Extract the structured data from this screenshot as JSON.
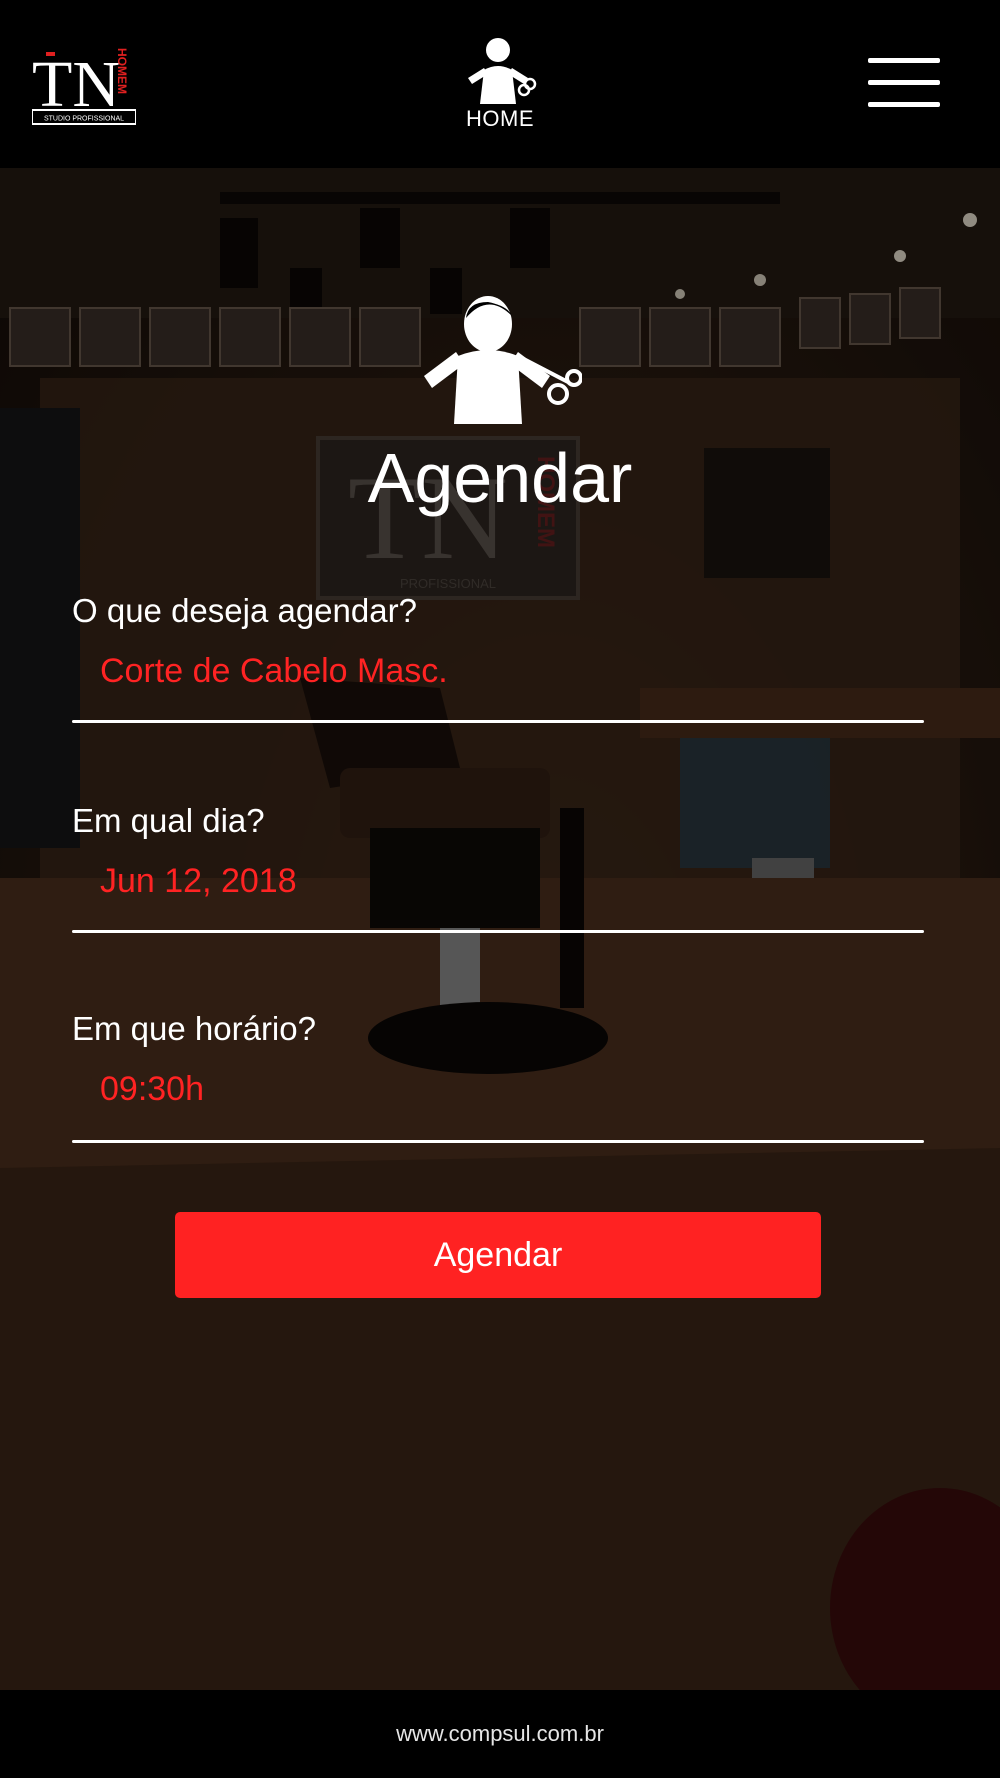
{
  "header": {
    "logo": {
      "letters": "TN",
      "vertical_text": "HOMEM",
      "subtitle": "STUDIO PROFISSIONAL"
    },
    "home_label": "HOME",
    "menu_icon": "hamburger-menu-icon"
  },
  "hero": {
    "icon": "barber-scissors-icon",
    "title": "Agendar",
    "background_logo": {
      "letters": "TN",
      "vertical_text": "HOMEM",
      "subtitle": "PROFISSIONAL"
    }
  },
  "form": {
    "service": {
      "label": "O que deseja agendar?",
      "value": "Corte de Cabelo Masc."
    },
    "date": {
      "label": "Em qual dia?",
      "value": "Jun 12, 2018"
    },
    "time": {
      "label": "Em que horário?",
      "value": "09:30h"
    },
    "submit_label": "Agendar"
  },
  "footer": {
    "text": "www.compsul.com.br"
  },
  "colors": {
    "accent": "#ff2222",
    "value_text": "#ff2323",
    "header_bg": "#000000",
    "text": "#ffffff"
  }
}
